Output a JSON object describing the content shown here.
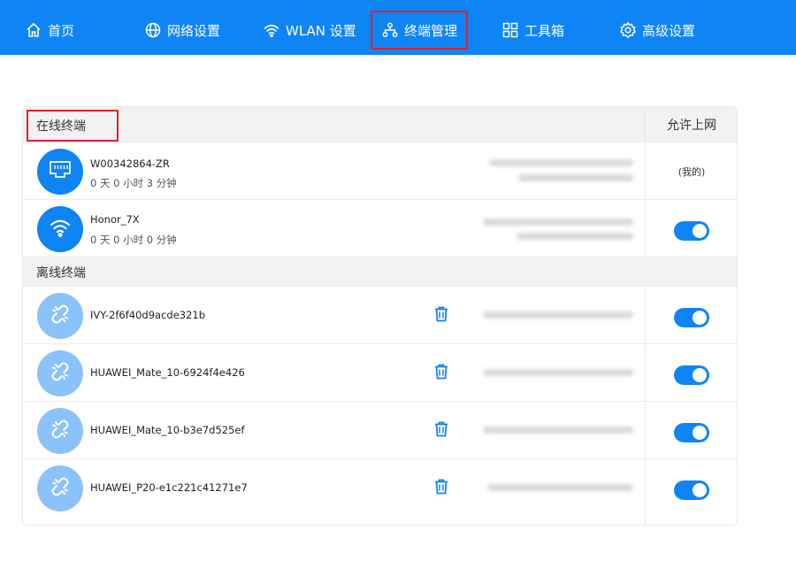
{
  "nav": {
    "items": [
      {
        "label": "首页",
        "icon": "home-icon"
      },
      {
        "label": "网络设置",
        "icon": "globe-icon"
      },
      {
        "label": "WLAN 设置",
        "icon": "wifi-icon"
      },
      {
        "label": "终端管理",
        "icon": "devices-icon",
        "active": true
      },
      {
        "label": "工具箱",
        "icon": "grid-icon"
      },
      {
        "label": "高级设置",
        "icon": "gear-icon"
      }
    ]
  },
  "table": {
    "online_title": "在线终端",
    "allow_header": "允许上网",
    "offline_title": "离线终端",
    "online": [
      {
        "name": "W00342864-ZR",
        "time": "0 天 0 小时 3 分钟",
        "icon": "ethernet-icon",
        "allow_label": "(我的)"
      },
      {
        "name": "Honor_7X",
        "time": "0 天 0 小时 0 分钟",
        "icon": "wifi-icon",
        "allow": true
      }
    ],
    "offline": [
      {
        "name": "IVY-2f6f40d9acde321b",
        "icon": "broken-link-icon",
        "allow": true
      },
      {
        "name": "HUAWEI_Mate_10-6924f4e426",
        "icon": "broken-link-icon",
        "allow": true
      },
      {
        "name": "HUAWEI_Mate_10-b3e7d525ef",
        "icon": "broken-link-icon",
        "allow": true
      },
      {
        "name": "HUAWEI_P20-e1c221c41271e7",
        "icon": "broken-link-icon",
        "allow": true
      }
    ]
  },
  "colors": {
    "accent": "#0f84f5",
    "offline_avatar": "#8cc2fa",
    "highlight": "#e4202a"
  }
}
